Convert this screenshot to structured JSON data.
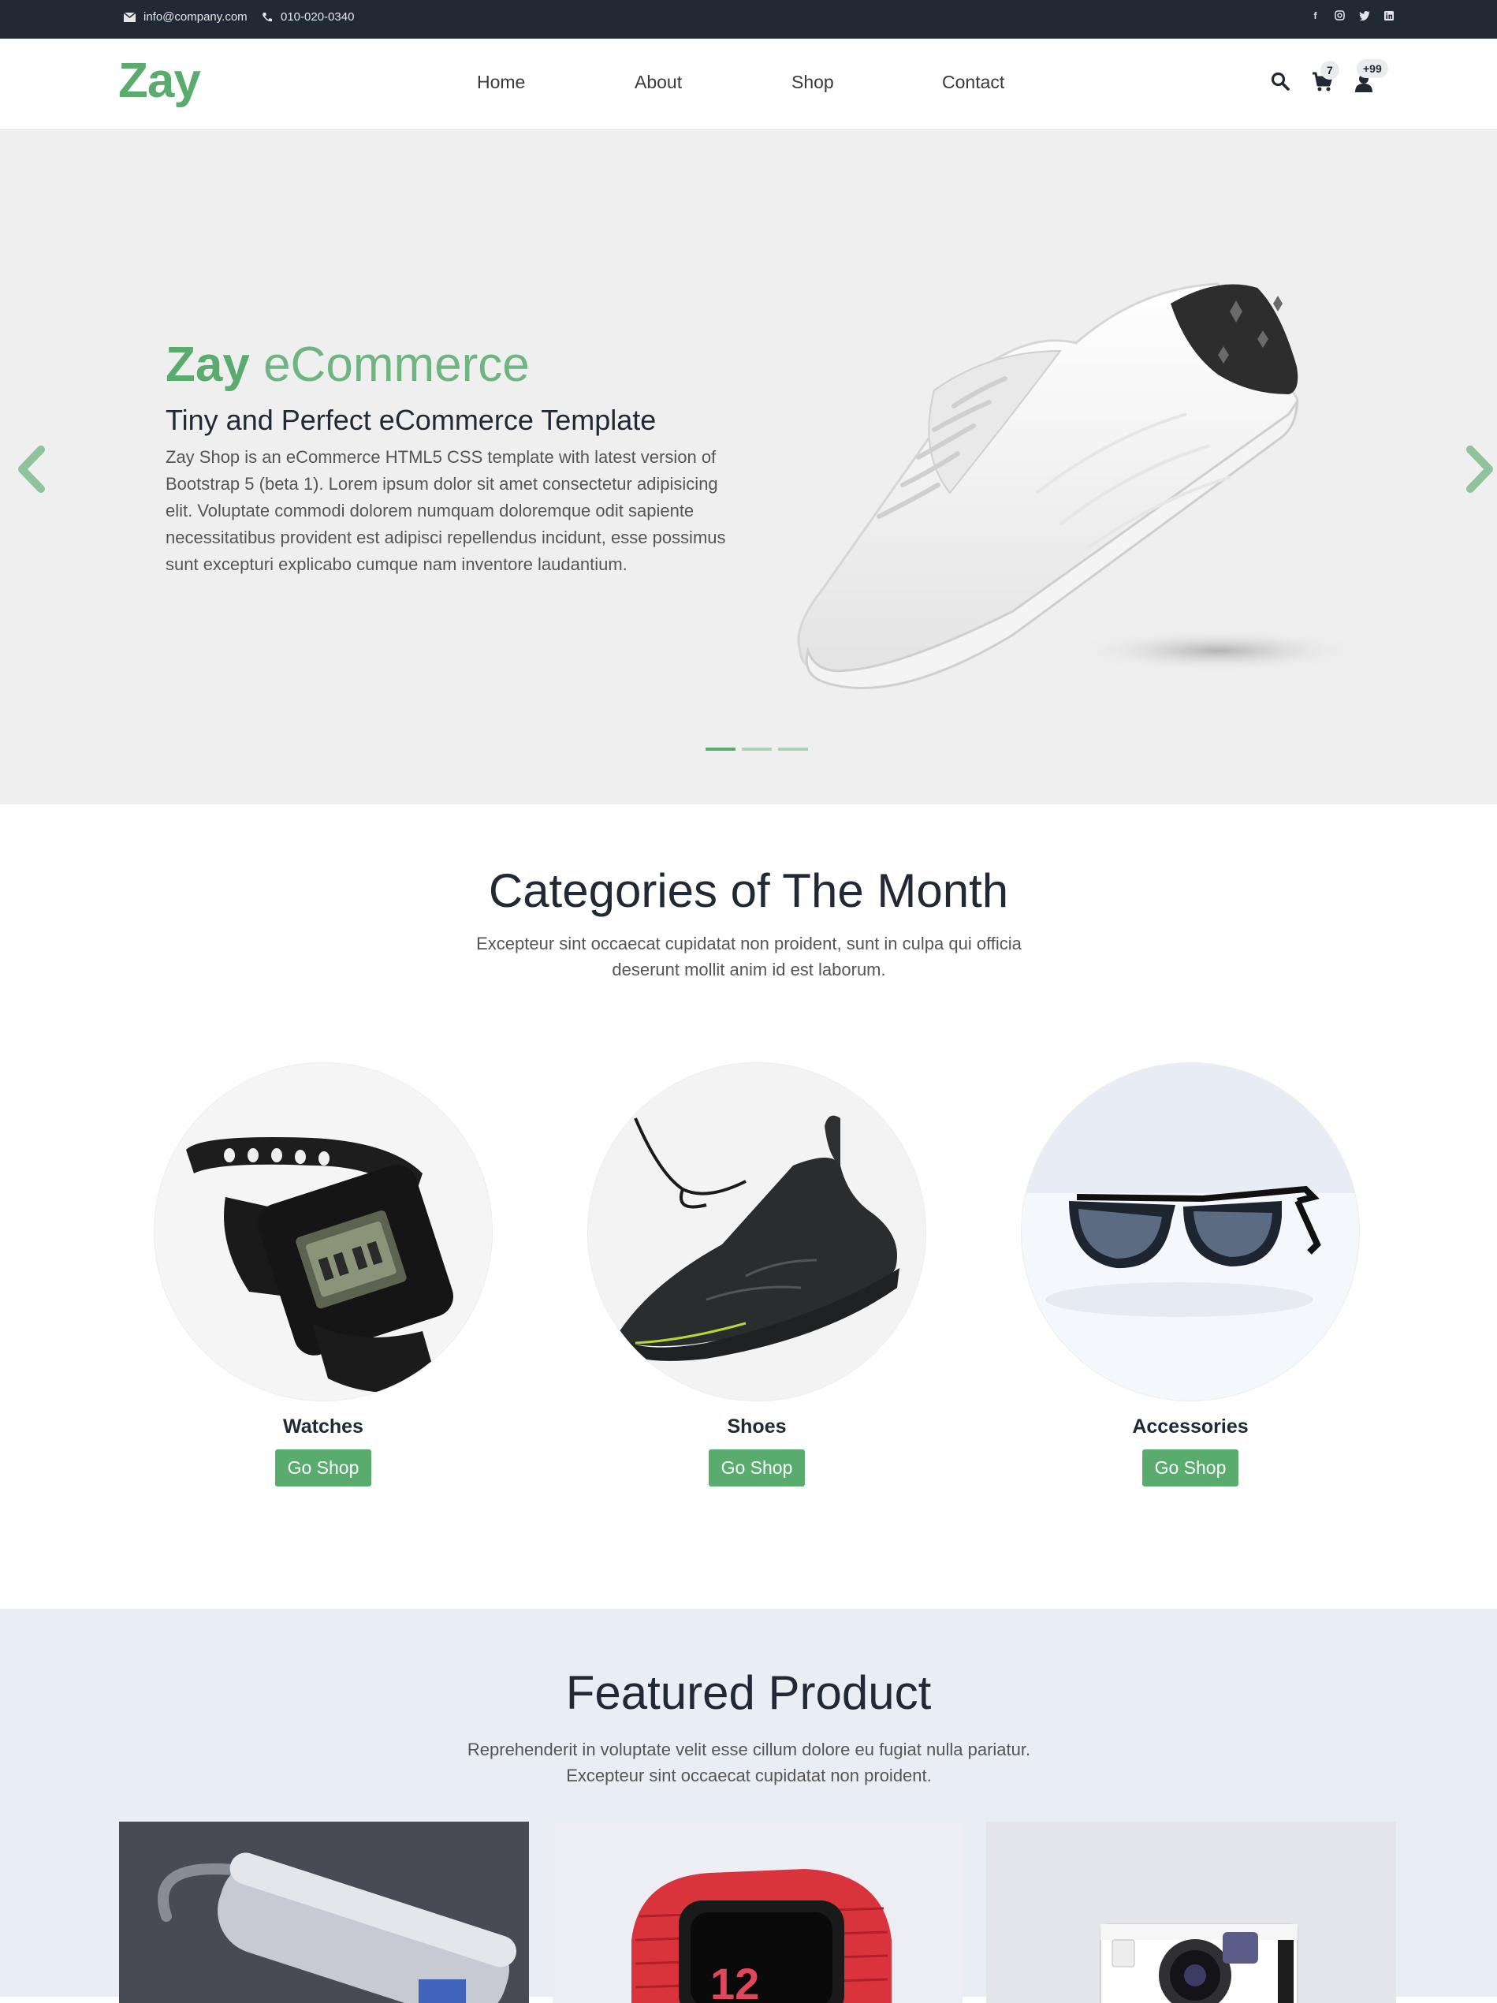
{
  "topbar": {
    "email": "info@company.com",
    "phone": "010-020-0340",
    "socials": [
      "facebook-icon",
      "instagram-icon",
      "twitter-icon",
      "linkedin-icon"
    ]
  },
  "header": {
    "logo": "Zay",
    "nav": [
      "Home",
      "About",
      "Shop",
      "Contact"
    ],
    "cart_count": "7",
    "user_count": "+99"
  },
  "hero": {
    "brand": "Zay",
    "title_rest": "eCommerce",
    "subtitle": "Tiny and Perfect eCommerce Template",
    "description": "Zay Shop is an eCommerce HTML5 CSS template with latest version of Bootstrap 5 (beta 1). Lorem ipsum dolor sit amet consectetur adipisicing elit. Voluptate commodi dolorem numquam doloremque odit sapiente necessitatibus provident est adipisci repellendus incidunt, esse possimus sunt excepturi explicabo cumque nam inventore laudantium.",
    "slides": 3,
    "active_slide": 1
  },
  "categories": {
    "title": "Categories of The Month",
    "subtitle": "Excepteur sint occaecat cupidatat non proident, sunt in culpa qui officia deserunt mollit anim id est laborum.",
    "items": [
      {
        "name": "Watches",
        "button": "Go Shop"
      },
      {
        "name": "Shoes",
        "button": "Go Shop"
      },
      {
        "name": "Accessories",
        "button": "Go Shop"
      }
    ]
  },
  "featured": {
    "title": "Featured Product",
    "subtitle_line1": "Reprehenderit in voluptate velit esse cillum dolore eu fugiat nulla pariatur.",
    "subtitle_line2": "Excepteur sint occaecat cupidatat non proident."
  },
  "colors": {
    "brand_green": "#59ab6e",
    "topbar_dark": "#212934",
    "hero_bg": "#efefef",
    "featured_bg": "#e9eef5"
  }
}
